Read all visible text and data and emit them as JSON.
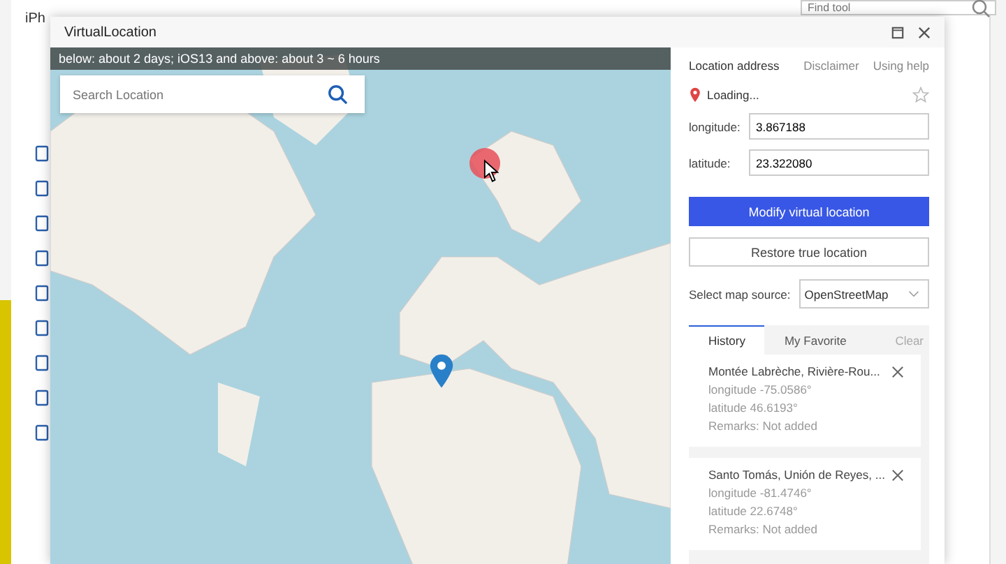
{
  "background_app": {
    "title": "iPh",
    "search": {
      "placeholder": "Find tool"
    }
  },
  "window": {
    "title": "VirtualLocation"
  },
  "map": {
    "notice": "below: about 2 days; iOS13 and above: about 3 ~ 6 hours",
    "search": {
      "placeholder": "Search Location"
    }
  },
  "panel": {
    "heading": "Location address",
    "links": [
      "Disclaimer",
      "Using help"
    ],
    "address": "Loading...",
    "favorite": false,
    "fields": [
      {
        "label": "longitude:",
        "value": "3.867188"
      },
      {
        "label": "latitude:",
        "value": "23.322080"
      }
    ],
    "buttons": [
      {
        "label": "Modify virtual location",
        "kind": "primary"
      },
      {
        "label": "Restore true location",
        "kind": "secondary"
      }
    ],
    "map_source": {
      "label": "Select map source:",
      "value": "OpenStreetMap"
    },
    "tabs": [
      {
        "label": "History",
        "selected": true
      },
      {
        "label": "My Favorite",
        "selected": false
      }
    ],
    "clear": "Clear",
    "history": [
      {
        "name": "Montée Labrèche, Rivière-Rou...",
        "longitude": "longitude -75.0586°",
        "latitude": "latitude 46.6193°",
        "remarks": "Remarks: Not added"
      },
      {
        "name": "Santo Tomás, Unión de Reyes, ...",
        "longitude": "longitude -81.4746°",
        "latitude": "latitude 22.6748°",
        "remarks": "Remarks: Not added"
      }
    ]
  }
}
